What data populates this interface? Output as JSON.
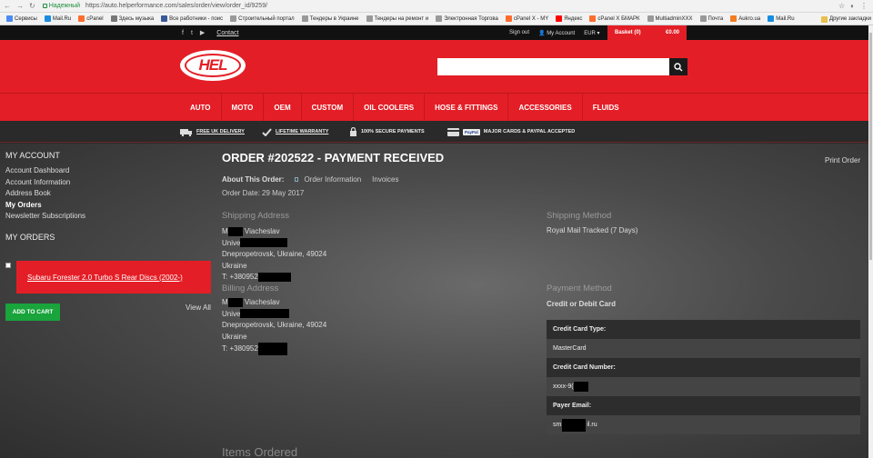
{
  "browser": {
    "secure_label": "Надежный",
    "url": "https://auto.helperformance.com/sales/order/view/order_id/9259/",
    "bookmarks": [
      {
        "label": "Сервисы",
        "color": "#4a8af4"
      },
      {
        "label": "Mail.Ru",
        "color": "#168de2"
      },
      {
        "label": "cPanel",
        "color": "#ff6c2c"
      },
      {
        "label": "Здесь музыка",
        "color": "#777777"
      },
      {
        "label": "Все работники - поис",
        "color": "#3b5998"
      },
      {
        "label": "Строительный портал",
        "color": "#999999"
      },
      {
        "label": "Тендеры в Украине",
        "color": "#999999"
      },
      {
        "label": "Тендеры на ремонт и",
        "color": "#999999"
      },
      {
        "label": "Электронная Торгова",
        "color": "#999999"
      },
      {
        "label": "cPanel X - MY",
        "color": "#ff6c2c"
      },
      {
        "label": "Яндекс",
        "color": "#ff0000"
      },
      {
        "label": "cPanel X БМАРК",
        "color": "#ff6c2c"
      },
      {
        "label": "MultiadminXXX",
        "color": "#999999"
      },
      {
        "label": "Почта",
        "color": "#999999"
      },
      {
        "label": "Aukro.ua",
        "color": "#f47c20"
      },
      {
        "label": "Mail.Ru",
        "color": "#168de2"
      }
    ],
    "other_bookmarks": "Другие закладки"
  },
  "topbar": {
    "contact": "Contact",
    "sign_out": "Sign out",
    "my_account": "My Account",
    "currency": "EUR",
    "basket": "Basket (0)",
    "basket_total": "€0.00"
  },
  "header": {
    "logo_text": "HEL",
    "search_placeholder": ""
  },
  "nav": [
    {
      "label": "AUTO",
      "caret": false
    },
    {
      "label": "MOTO",
      "caret": false
    },
    {
      "label": "OEM",
      "caret": false
    },
    {
      "label": "CUSTOM",
      "caret": false
    },
    {
      "label": "OIL COOLERS",
      "caret": false
    },
    {
      "label": "HOSE & FITTINGS",
      "caret": false
    },
    {
      "label": "ACCESSORIES",
      "caret": false
    },
    {
      "label": "FLUIDS",
      "caret": false
    }
  ],
  "benefits": {
    "delivery": "FREE UK DELIVERY",
    "warranty": "LIFETIME WARRANTY",
    "secure": "100% SECURE PAYMENTS",
    "cards": "MAJOR CARDS & PAYPAL ACCEPTED",
    "paypal_badge": "PayPal"
  },
  "sidebar": {
    "title": "MY ACCOUNT",
    "links": [
      {
        "label": "Account Dashboard",
        "active": false
      },
      {
        "label": "Account Information",
        "active": false
      },
      {
        "label": "Address Book",
        "active": false
      },
      {
        "label": "My Orders",
        "active": true
      },
      {
        "label": "Newsletter Subscriptions",
        "active": false
      }
    ],
    "my_orders_title": "MY ORDERS",
    "product": "Subaru Forester 2.0 Turbo S Rear Discs (2002-)",
    "add_to_cart": "ADD TO CART",
    "view_all": "View All"
  },
  "main": {
    "title": "ORDER #202522 - PAYMENT RECEIVED",
    "print": "Print Order",
    "about_label": "About This Order:",
    "about_info": "Order Information",
    "about_invoices": "Invoices",
    "order_date": "Order Date: 29 May 2017",
    "shipping_address_h": "Shipping Address",
    "shipping": {
      "l1a": "M",
      "l1b": "Viacheslav",
      "l2": "Unive",
      "l3": "Dnepropetrovsk, Ukraine, 49024",
      "l4": "Ukraine",
      "l5": "T: +380952"
    },
    "shipping_method_h": "Shipping Method",
    "shipping_method": "Royal Mail Tracked (7 Days)",
    "billing_address_h": "Billing Address",
    "billing": {
      "l1a": "M",
      "l1b": "Viacheslav",
      "l2": "Unive",
      "l3": "Dnepropetrovsk, Ukraine, 49024",
      "l4": "Ukraine",
      "l5": "T: +380952"
    },
    "payment_method_h": "Payment Method",
    "payment_sub": "Credit or Debit Card",
    "payment_table": {
      "card_type_label": "Credit Card Type:",
      "card_type": "MasterCard",
      "card_number_label": "Credit Card Number:",
      "card_number": "xxxx-9(",
      "payer_email_label": "Payer Email:",
      "payer_email_a": "sm",
      "payer_email_b": "il.ru"
    },
    "items_ordered_h": "Items Ordered"
  }
}
